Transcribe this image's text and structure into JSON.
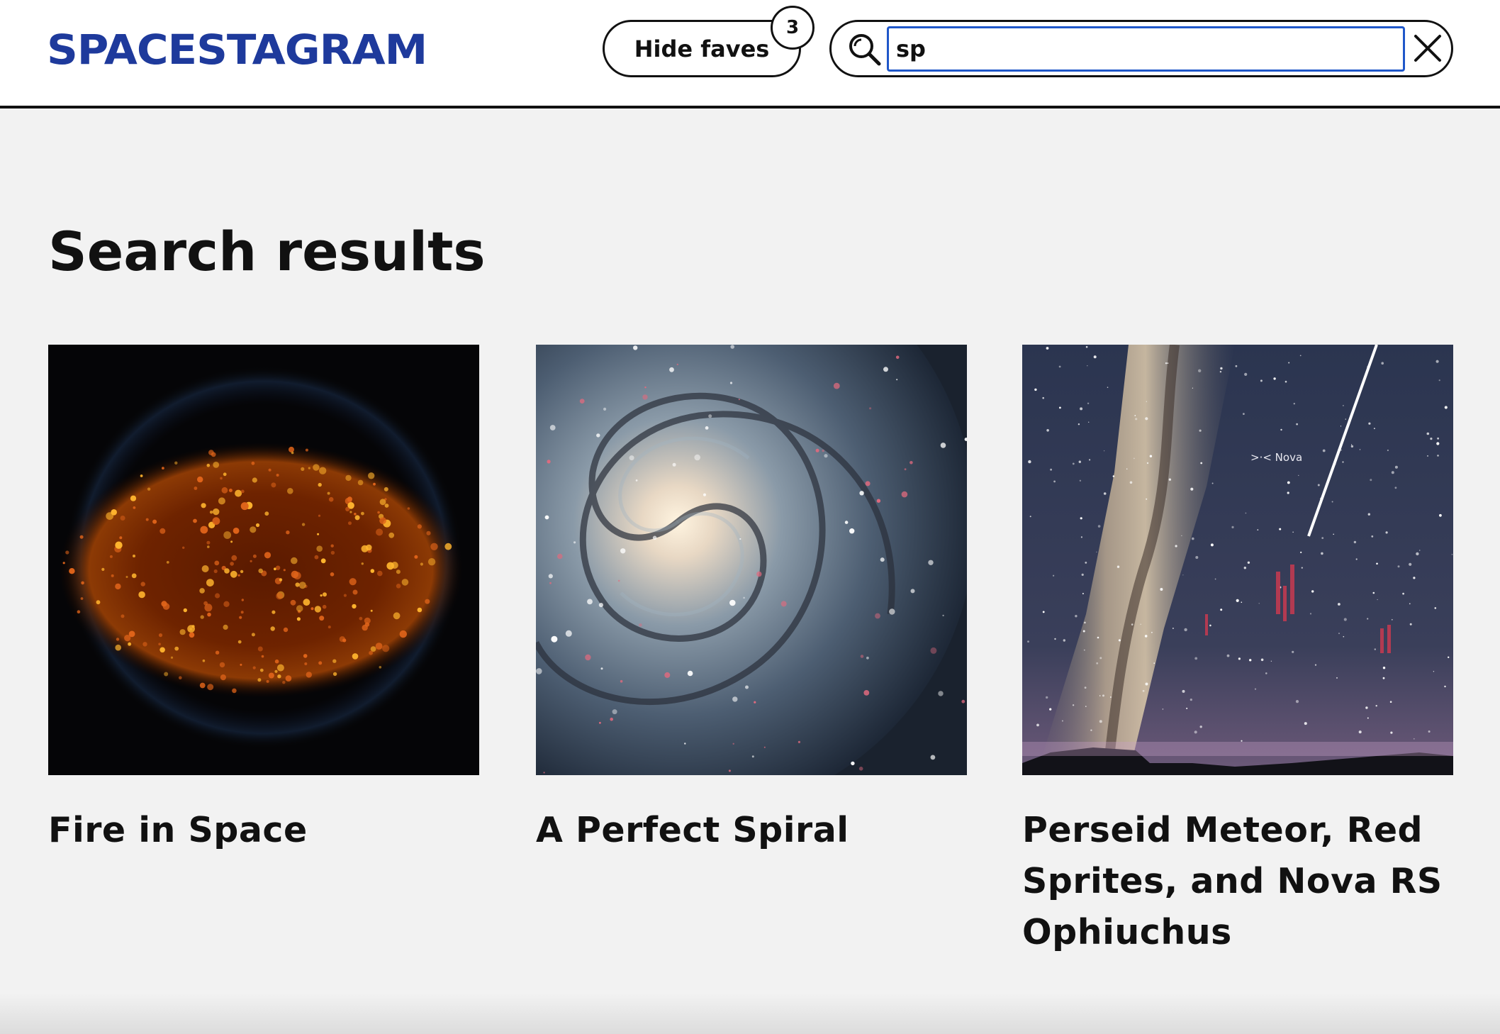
{
  "header": {
    "logo": "SPACESTAGRAM",
    "faves_button_label": "Hide faves",
    "faves_count": "3",
    "search": {
      "value": "sp",
      "placeholder": ""
    },
    "icons": {
      "search": "search-icon",
      "clear": "close-icon"
    }
  },
  "main": {
    "title": "Search results",
    "results": [
      {
        "title": "Fire in Space",
        "image": "fire-in-space-image"
      },
      {
        "title": "A Perfect Spiral",
        "image": "spiral-galaxy-image"
      },
      {
        "title": "Perseid Meteor, Red Sprites, and Nova RS Ophiuchus",
        "image": "milky-way-meteor-image",
        "image_label": ">·< Nova"
      }
    ]
  },
  "colors": {
    "brand": "#1e3a9c",
    "focus": "#1f57c9",
    "background": "#f2f2f2",
    "text": "#111111"
  }
}
